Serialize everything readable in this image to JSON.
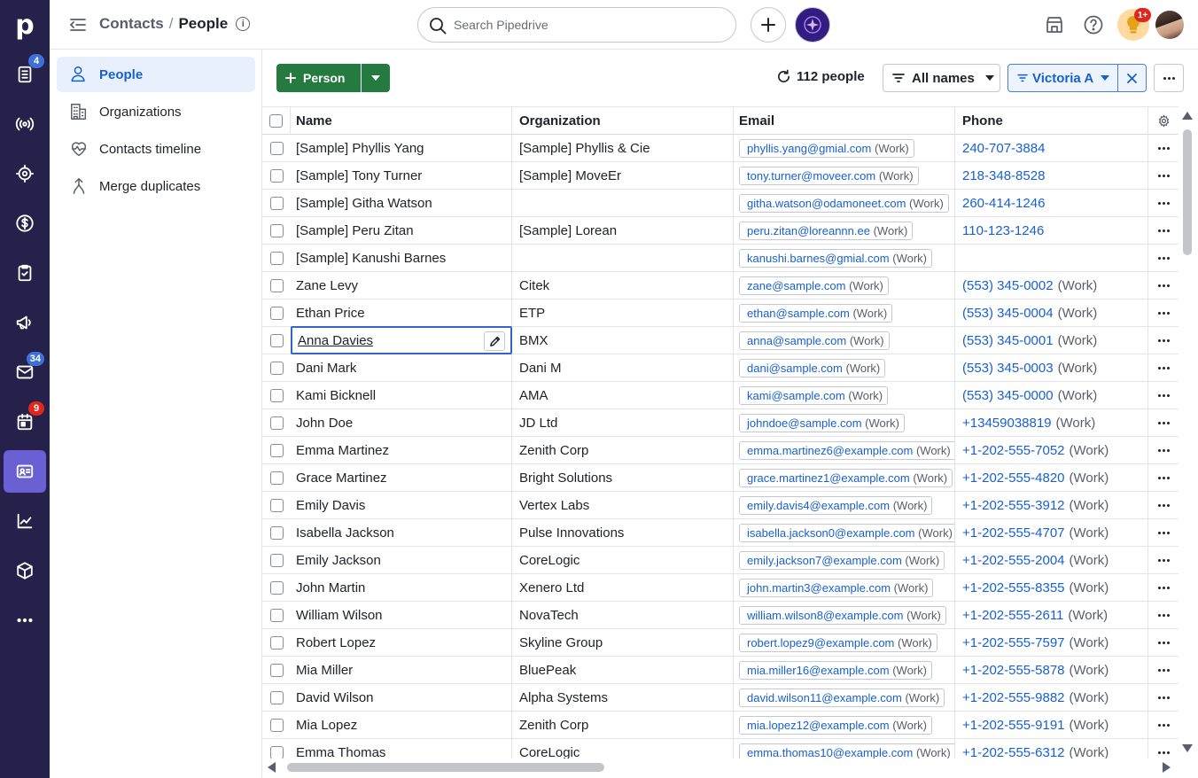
{
  "rail": {
    "logo": "p",
    "items": [
      {
        "name": "deals-icon",
        "badge": "4",
        "badge_color": "#3f6fd8"
      },
      {
        "name": "leads-icon"
      },
      {
        "name": "insights-target-icon"
      },
      {
        "name": "dollar-icon"
      },
      {
        "name": "tasks-icon"
      },
      {
        "name": "campaigns-icon"
      },
      {
        "name": "mail-icon",
        "badge": "34",
        "badge_color": "#3f6fd8"
      },
      {
        "name": "calendar-icon",
        "badge": "9",
        "badge_color": "#e0261e"
      },
      {
        "name": "contacts-icon",
        "active": true
      },
      {
        "name": "reports-icon"
      },
      {
        "name": "products-icon"
      },
      {
        "name": "more-icon"
      }
    ]
  },
  "header": {
    "crumb_parent": "Contacts",
    "crumb_sep": "/",
    "crumb_current": "People",
    "info": "i",
    "search_placeholder": "Search Pipedrive",
    "bulb_badge": "1+"
  },
  "subnav": [
    {
      "label": "People",
      "active": true,
      "icon": "person-icon"
    },
    {
      "label": "Organizations",
      "icon": "building-icon"
    },
    {
      "label": "Contacts timeline",
      "icon": "heart-pulse-icon"
    },
    {
      "label": "Merge duplicates",
      "icon": "merge-icon"
    }
  ],
  "toolbar": {
    "add_label": "Person",
    "count_label": "112 people",
    "filter_names": "All names",
    "filter_owner": "Victoria A"
  },
  "table": {
    "columns": [
      "Name",
      "Organization",
      "Email",
      "Phone"
    ],
    "email_label": "(Work)",
    "phone_label": "(Work)",
    "rows": [
      {
        "name": "[Sample] Phyllis Yang",
        "org": "[Sample] Phyllis & Cie",
        "email": "phyllis.yang@gmial.com",
        "phone": "240-707-3884",
        "phone_work": false
      },
      {
        "name": "[Sample] Tony Turner",
        "org": "[Sample] MoveEr",
        "email": "tony.turner@moveer.com",
        "phone": "218-348-8528",
        "phone_work": false
      },
      {
        "name": "[Sample] Githa Watson",
        "org": "",
        "email": "githa.watson@odamoneet.com",
        "phone": "260-414-1246",
        "phone_work": false
      },
      {
        "name": "[Sample] Peru Zitan",
        "org": "[Sample] Lorean",
        "email": "peru.zitan@loreannn.ee",
        "phone": "110-123-1246",
        "phone_work": false
      },
      {
        "name": "[Sample] Kanushi Barnes",
        "org": "",
        "email": "kanushi.barnes@gmial.com",
        "phone": "",
        "phone_work": false
      },
      {
        "name": "Zane Levy",
        "org": "Citek",
        "email": "zane@sample.com",
        "phone": "(553) 345-0002",
        "phone_work": true
      },
      {
        "name": "Ethan Price",
        "org": "ETP",
        "email": "ethan@sample.com",
        "phone": "(553) 345-0004",
        "phone_work": true
      },
      {
        "name": "Anna Davies",
        "org": "BMX",
        "email": "anna@sample.com",
        "phone": "(553) 345-0001",
        "phone_work": true,
        "selected": true
      },
      {
        "name": "Dani Mark",
        "org": "Dani M",
        "email": "dani@sample.com",
        "phone": "(553) 345-0003",
        "phone_work": true
      },
      {
        "name": "Kami Bicknell",
        "org": "AMA",
        "email": "kami@sample.com",
        "phone": "(553) 345-0000",
        "phone_work": true
      },
      {
        "name": "John Doe",
        "org": "JD Ltd",
        "email": "johndoe@sample.com",
        "phone": "+13459038819",
        "phone_work": true
      },
      {
        "name": "Emma Martinez",
        "org": "Zenith Corp",
        "email": "emma.martinez6@example.com",
        "phone": "+1-202-555-7052",
        "phone_work": true
      },
      {
        "name": "Grace Martinez",
        "org": "Bright Solutions",
        "email": "grace.martinez1@example.com",
        "phone": "+1-202-555-4820",
        "phone_work": true
      },
      {
        "name": "Emily Davis",
        "org": "Vertex Labs",
        "email": "emily.davis4@example.com",
        "phone": "+1-202-555-3912",
        "phone_work": true
      },
      {
        "name": "Isabella Jackson",
        "org": "Pulse Innovations",
        "email": "isabella.jackson0@example.com",
        "phone": "+1-202-555-4707",
        "phone_work": true
      },
      {
        "name": "Emily Jackson",
        "org": "CoreLogic",
        "email": "emily.jackson7@example.com",
        "phone": "+1-202-555-2004",
        "phone_work": true
      },
      {
        "name": "John Martin",
        "org": "Xenero Ltd",
        "email": "john.martin3@example.com",
        "phone": "+1-202-555-8355",
        "phone_work": true
      },
      {
        "name": "William Wilson",
        "org": "NovaTech",
        "email": "william.wilson8@example.com",
        "phone": "+1-202-555-2611",
        "phone_work": true
      },
      {
        "name": "Robert Lopez",
        "org": "Skyline Group",
        "email": "robert.lopez9@example.com",
        "phone": "+1-202-555-7597",
        "phone_work": true
      },
      {
        "name": "Mia Miller",
        "org": "BluePeak",
        "email": "mia.miller16@example.com",
        "phone": "+1-202-555-5878",
        "phone_work": true
      },
      {
        "name": "David Wilson",
        "org": "Alpha Systems",
        "email": "david.wilson11@example.com",
        "phone": "+1-202-555-9882",
        "phone_work": true
      },
      {
        "name": "Mia Lopez",
        "org": "Zenith Corp",
        "email": "mia.lopez12@example.com",
        "phone": "+1-202-555-9191",
        "phone_work": true
      },
      {
        "name": "Emma Thomas",
        "org": "CoreLogic",
        "email": "emma.thomas10@example.com",
        "phone": "+1-202-555-6312",
        "phone_work": true
      }
    ]
  }
}
